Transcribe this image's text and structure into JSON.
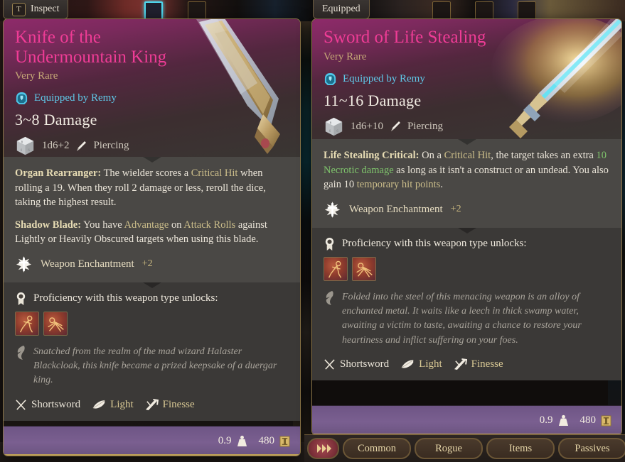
{
  "tabs": {
    "inspect": {
      "key": "T",
      "label": "Inspect"
    },
    "equipped": {
      "label": "Equipped"
    }
  },
  "left_item": {
    "name": "Knife of the Undermountain King",
    "rarity": "Very Rare",
    "equipped_by": "Equipped by Remy",
    "damage": "3~8 Damage",
    "dice": "1d6+2",
    "damage_type": "Piercing",
    "effects": [
      {
        "title": "Organ Rearranger:",
        "parts": [
          {
            "text": " The wielder scores a ",
            "style": "plain"
          },
          {
            "text": "Critical Hit",
            "style": "hl"
          },
          {
            "text": " when rolling a 19. When they roll 2 damage or less, reroll the dice, taking the highest result.",
            "style": "plain"
          }
        ]
      },
      {
        "title": "Shadow Blade:",
        "parts": [
          {
            "text": " You have ",
            "style": "plain"
          },
          {
            "text": "Advantage",
            "style": "hl"
          },
          {
            "text": " on ",
            "style": "plain"
          },
          {
            "text": "Attack Rolls",
            "style": "hl"
          },
          {
            "text": " against Lightly or Heavily Obscured targets when using this blade.",
            "style": "plain"
          }
        ]
      }
    ],
    "enchantment_label": "Weapon Enchantment",
    "enchantment_value": "+2",
    "proficiency_title": "Proficiency with this weapon type unlocks:",
    "proficiency_icons": [
      "piercing-strike-skill-icon",
      "rush-attack-skill-icon"
    ],
    "flavor": "Snatched from the realm of the mad wizard Halaster Blackcloak, this knife became a prized keepsake of a duergar king.",
    "properties": [
      {
        "icon": "crossed-swords-icon",
        "label": "Shortsword",
        "color": "white"
      },
      {
        "icon": "feather-icon",
        "label": "Light",
        "color": "gold"
      },
      {
        "icon": "finesse-arrow-icon",
        "label": "Finesse",
        "color": "gold"
      }
    ],
    "weight": "0.9",
    "value": "480"
  },
  "right_item": {
    "name": "Sword of Life Stealing",
    "rarity": "Very Rare",
    "equipped_by": "Equipped by Remy",
    "damage": "11~16 Damage",
    "dice": "1d6+10",
    "damage_type": "Piercing",
    "effects": [
      {
        "title": "Life Stealing Critical:",
        "parts": [
          {
            "text": " On a ",
            "style": "plain"
          },
          {
            "text": "Critical Hit",
            "style": "hl"
          },
          {
            "text": ", the target takes an extra ",
            "style": "plain"
          },
          {
            "text": "10 Necrotic damage",
            "style": "green"
          },
          {
            "text": " as long as it isn't a construct or an undead. You also gain 10 ",
            "style": "plain"
          },
          {
            "text": "temporary hit points",
            "style": "hl"
          },
          {
            "text": ".",
            "style": "plain"
          }
        ]
      }
    ],
    "enchantment_label": "Weapon Enchantment",
    "enchantment_value": "+2",
    "proficiency_title": "Proficiency with this weapon type unlocks:",
    "proficiency_icons": [
      "piercing-strike-skill-icon",
      "rush-attack-skill-icon"
    ],
    "flavor": "Folded into the steel of this menacing weapon is an alloy of enchanted metal. It waits like a leech in thick swamp water, awaiting a victim to taste, awaiting a chance to restore your heartiness and inflict suffering on your foes.",
    "properties": [
      {
        "icon": "crossed-swords-icon",
        "label": "Shortsword",
        "color": "white"
      },
      {
        "icon": "feather-icon",
        "label": "Light",
        "color": "gold"
      },
      {
        "icon": "finesse-arrow-icon",
        "label": "Finesse",
        "color": "gold"
      }
    ],
    "weight": "0.9",
    "value": "480"
  },
  "hotbar": {
    "toggle_icon": "chevrons-right-icon",
    "tabs": [
      "Common",
      "Rogue",
      "Items",
      "Passives",
      ""
    ]
  },
  "colors": {
    "item_name": "#ef3c96",
    "rarity": "#c6a877",
    "equipped": "#5fc8e8",
    "highlight": "#cbbd8a",
    "necrotic": "#7fc46c",
    "border_gold": "#8a7447",
    "footer_purple": "#7a5f90"
  }
}
